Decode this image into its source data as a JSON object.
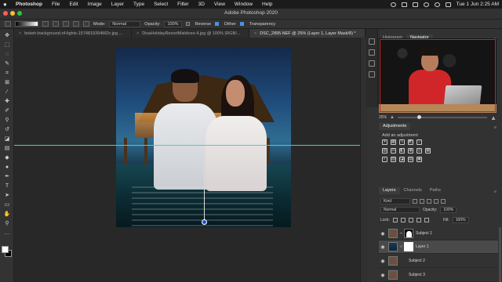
{
  "menubar": {
    "app_name": "Photoshop",
    "items": [
      "File",
      "Edit",
      "Image",
      "Layer",
      "Type",
      "Select",
      "Filter",
      "3D",
      "View",
      "Window",
      "Help"
    ],
    "clock": "Tue 1 Jun  2:25 AM"
  },
  "window": {
    "title": "Adobe Photoshop 2020"
  },
  "options": {
    "mode_label": "Mode:",
    "mode_value": "Normal",
    "opacity_label": "Opacity:",
    "opacity_value": "100%",
    "reverse_label": "Reverse",
    "dither_label": "Dither",
    "transparency_label": "Transparency"
  },
  "tabs": [
    {
      "label": "bokeh-background-of-lights-1574819394MZn.jpg ...",
      "active": false
    },
    {
      "label": "DivaHolidayResortMaldives-4.jpg @ 100% (RGB/...",
      "active": false
    },
    {
      "label": "DSC_2895.NEF @ 25% (Layer 1, Layer Mask/8) *",
      "active": true
    }
  ],
  "navigator": {
    "tabs": [
      "Histogram",
      "Navigator"
    ],
    "active_tab": "Navigator",
    "zoom": "25%",
    "zoom_fraction": 0.22
  },
  "adjustments": {
    "title": "Adjustments",
    "add_label": "Add an adjustment"
  },
  "layers": {
    "tabs": [
      "Layers",
      "Channels",
      "Paths"
    ],
    "active_tab": "Layers",
    "filter_label": "Kind",
    "blend_mode": "Normal",
    "opacity_label": "Opacity:",
    "opacity_value": "100%",
    "lock_label": "Lock:",
    "fill_label": "Fill:",
    "fill_value": "100%",
    "items": [
      {
        "name": "Subject 1",
        "selected": false
      },
      {
        "name": "Layer 1",
        "selected": true
      },
      {
        "name": "Subject 2",
        "selected": false
      },
      {
        "name": "Subject 3",
        "selected": false
      }
    ]
  },
  "colors": {
    "guide": "#38d4d8",
    "selection": "#4a4a4a",
    "navigator_view": "#d32020"
  }
}
